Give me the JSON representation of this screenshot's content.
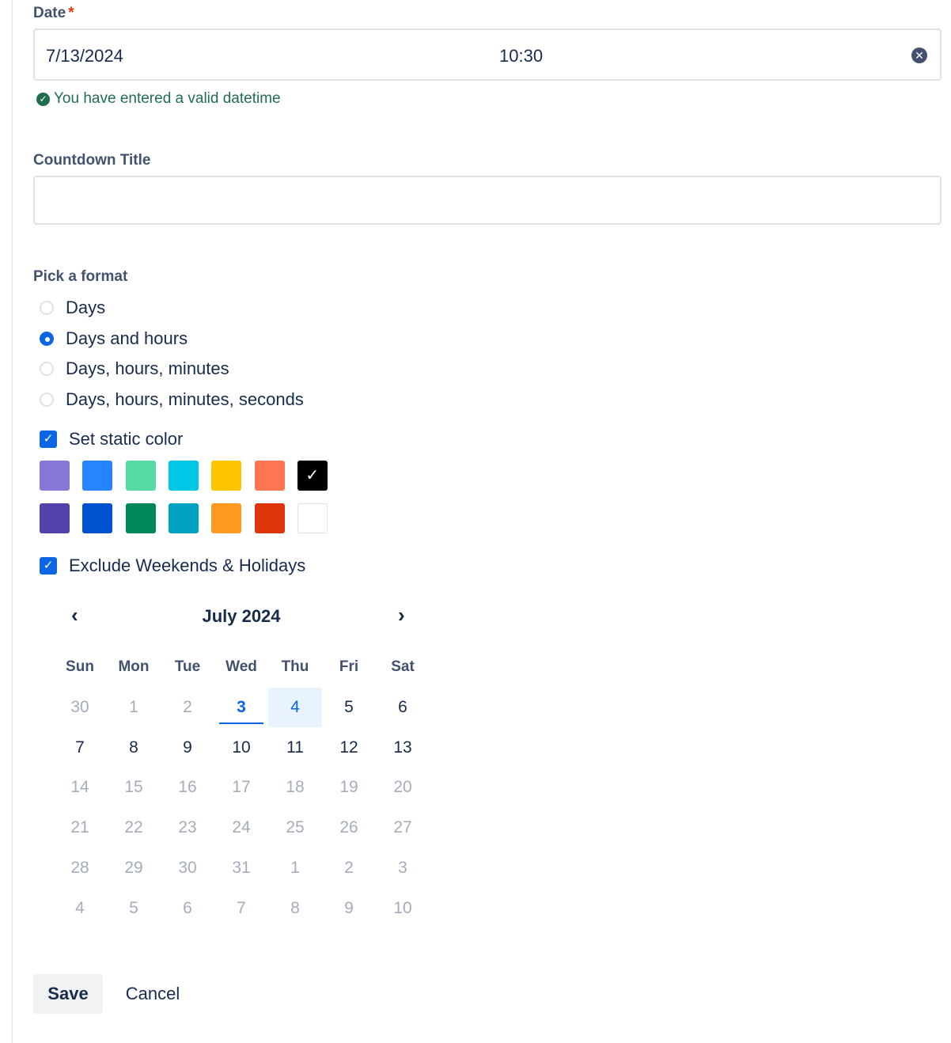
{
  "date_field": {
    "label": "Date",
    "required_mark": "*",
    "date_value": "7/13/2024",
    "time_value": "10:30",
    "valid_message": "You have entered a valid datetime"
  },
  "title_field": {
    "label": "Countdown Title",
    "value": ""
  },
  "format": {
    "label": "Pick a format",
    "options": [
      {
        "label": "Days",
        "selected": false
      },
      {
        "label": "Days and hours",
        "selected": true
      },
      {
        "label": "Days, hours, minutes",
        "selected": false
      },
      {
        "label": "Days, hours, minutes, seconds",
        "selected": false
      }
    ]
  },
  "static_color": {
    "label": "Set static color",
    "checked": true,
    "swatches_row1": [
      "#8777d9",
      "#2684ff",
      "#57d9a3",
      "#00c7e6",
      "#ffc400",
      "#ff7452",
      "#000000"
    ],
    "swatches_row2": [
      "#5243aa",
      "#0052cc",
      "#00875a",
      "#00a3bf",
      "#ff991f",
      "#de350b",
      "#ffffff"
    ],
    "selected_color": "#000000"
  },
  "exclude": {
    "label": "Exclude Weekends & Holidays",
    "checked": true
  },
  "calendar": {
    "month_label": "July 2024",
    "weekdays": [
      "Sun",
      "Mon",
      "Tue",
      "Wed",
      "Thu",
      "Fri",
      "Sat"
    ],
    "weeks": [
      [
        "30",
        "1",
        "2",
        "3",
        "4",
        "5",
        "6"
      ],
      [
        "7",
        "8",
        "9",
        "10",
        "11",
        "12",
        "13"
      ],
      [
        "14",
        "15",
        "16",
        "17",
        "18",
        "19",
        "20"
      ],
      [
        "21",
        "22",
        "23",
        "24",
        "25",
        "26",
        "27"
      ],
      [
        "28",
        "29",
        "30",
        "31",
        "1",
        "2",
        "3"
      ],
      [
        "4",
        "5",
        "6",
        "7",
        "8",
        "9",
        "10"
      ]
    ],
    "today": "3",
    "selected": "4"
  },
  "actions": {
    "save_label": "Save",
    "cancel_label": "Cancel"
  }
}
